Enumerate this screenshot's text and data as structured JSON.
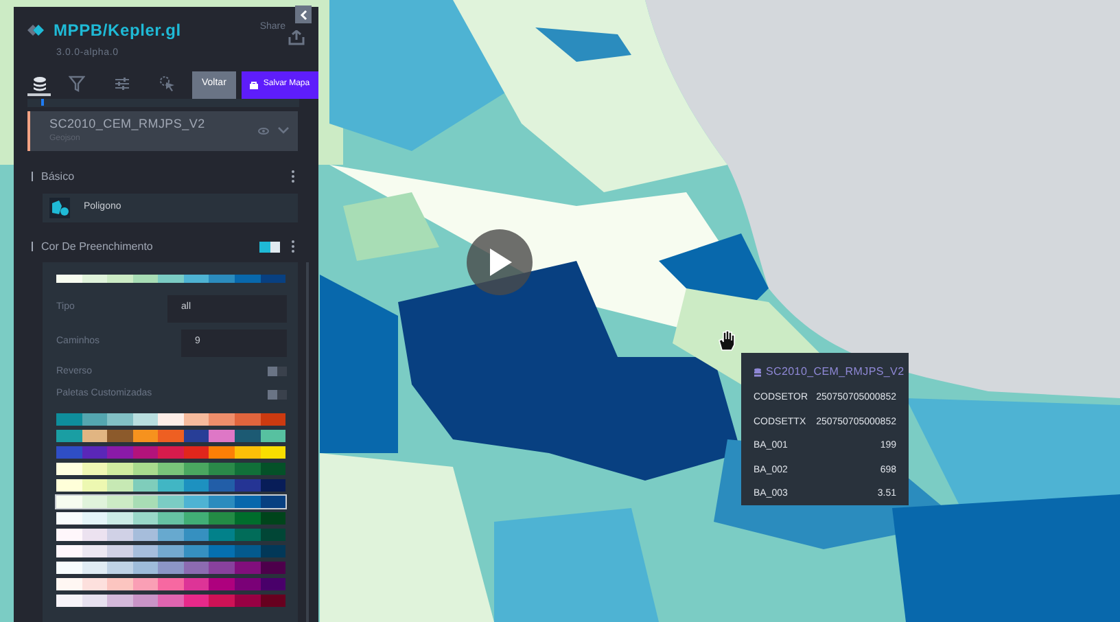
{
  "header": {
    "title": "MPPB/Kepler.gl",
    "version": "3.0.0-alpha.0",
    "share_label": "Share"
  },
  "tabs": [
    {
      "selected": true
    },
    {
      "selected": false
    },
    {
      "selected": false
    },
    {
      "selected": false
    }
  ],
  "buttons": [
    {
      "label": "Voltar",
      "kind": "secondary"
    },
    {
      "label": "Salvar Mapa",
      "kind": "primary"
    }
  ],
  "layer": {
    "name": "SC2010_CEM_RMJPS_V2",
    "source": "Geojson"
  },
  "basic_section": {
    "title": "Básico",
    "layer_type": "Poligono"
  },
  "fill_section": {
    "title": "Cor De Preenchimento",
    "scale": [
      {
        "color": "#f7fcf0"
      },
      {
        "color": "#e0f3db"
      },
      {
        "color": "#ccebc5"
      },
      {
        "color": "#a8ddb5"
      },
      {
        "color": "#7bccc4"
      },
      {
        "color": "#4eb3d3"
      },
      {
        "color": "#2b8cbe"
      },
      {
        "color": "#0868ac"
      },
      {
        "color": "#084081"
      }
    ],
    "fields": [
      {
        "label": "Tipo",
        "value": "all"
      },
      {
        "label": "Caminhos",
        "value": "9"
      }
    ],
    "toggles": [
      {
        "label": "Reverso",
        "on": false
      },
      {
        "label": "Paletas Customizadas",
        "on": false
      }
    ],
    "palettes": [
      {
        "selected": false,
        "colors": [
          {
            "color": "#0e8e9c"
          },
          {
            "color": "#54a6b0"
          },
          {
            "color": "#82c0c5"
          },
          {
            "color": "#b9dedf"
          },
          {
            "color": "#fdeee8"
          },
          {
            "color": "#f6bb9d"
          },
          {
            "color": "#ee8e6b"
          },
          {
            "color": "#e1653d"
          },
          {
            "color": "#cc3a10"
          }
        ]
      },
      {
        "selected": false,
        "colors": [
          {
            "color": "#1a9ea3"
          },
          {
            "color": "#e1b582"
          },
          {
            "color": "#8c5a2b"
          },
          {
            "color": "#f6921e"
          },
          {
            "color": "#ee5f22"
          },
          {
            "color": "#283e97"
          },
          {
            "color": "#de77c6"
          },
          {
            "color": "#1c5a73"
          },
          {
            "color": "#57c1a0"
          }
        ]
      },
      {
        "selected": false,
        "colors": [
          {
            "color": "#2f4ec5"
          },
          {
            "color": "#5a27b8"
          },
          {
            "color": "#8a1aa8"
          },
          {
            "color": "#b3137b"
          },
          {
            "color": "#d81b4c"
          },
          {
            "color": "#e1261c"
          },
          {
            "color": "#fb7f06"
          },
          {
            "color": "#fbbf08"
          },
          {
            "color": "#f9de00"
          }
        ]
      },
      {
        "selected": false,
        "colors": [
          {
            "color": "#ffffe0"
          },
          {
            "color": "#eff7b4"
          },
          {
            "color": "#d0eca0"
          },
          {
            "color": "#a9db8e"
          },
          {
            "color": "#79c47a"
          },
          {
            "color": "#4aa760"
          },
          {
            "color": "#2a8a49"
          },
          {
            "color": "#117039"
          },
          {
            "color": "#045128"
          }
        ]
      },
      {
        "selected": false,
        "colors": [
          {
            "color": "#ffffd9"
          },
          {
            "color": "#edf8b1"
          },
          {
            "color": "#c7e9b4"
          },
          {
            "color": "#7fcdbb"
          },
          {
            "color": "#41b6c4"
          },
          {
            "color": "#1d91c0"
          },
          {
            "color": "#225ea8"
          },
          {
            "color": "#253494"
          },
          {
            "color": "#081d58"
          }
        ]
      },
      {
        "selected": true,
        "colors": [
          {
            "color": "#f7fcf0"
          },
          {
            "color": "#e0f3db"
          },
          {
            "color": "#ccebc5"
          },
          {
            "color": "#a8ddb5"
          },
          {
            "color": "#7bccc4"
          },
          {
            "color": "#4eb3d3"
          },
          {
            "color": "#2b8cbe"
          },
          {
            "color": "#0868ac"
          },
          {
            "color": "#084081"
          }
        ]
      },
      {
        "selected": false,
        "colors": [
          {
            "color": "#f7fcfd"
          },
          {
            "color": "#e5f5f9"
          },
          {
            "color": "#ccece6"
          },
          {
            "color": "#99d8c9"
          },
          {
            "color": "#66c2a4"
          },
          {
            "color": "#41ae76"
          },
          {
            "color": "#238b45"
          },
          {
            "color": "#006d2c"
          },
          {
            "color": "#00441b"
          }
        ]
      },
      {
        "selected": false,
        "colors": [
          {
            "color": "#fff7fb"
          },
          {
            "color": "#ece2f0"
          },
          {
            "color": "#d0d1e6"
          },
          {
            "color": "#a6bddb"
          },
          {
            "color": "#67a9cf"
          },
          {
            "color": "#3690c0"
          },
          {
            "color": "#02818a"
          },
          {
            "color": "#016c59"
          },
          {
            "color": "#014636"
          }
        ]
      },
      {
        "selected": false,
        "colors": [
          {
            "color": "#fff7fc"
          },
          {
            "color": "#ece7f2"
          },
          {
            "color": "#d0d1e5"
          },
          {
            "color": "#a6bddc"
          },
          {
            "color": "#74a9cf"
          },
          {
            "color": "#3690c1"
          },
          {
            "color": "#0570b0"
          },
          {
            "color": "#045a8d"
          },
          {
            "color": "#023858"
          }
        ]
      },
      {
        "selected": false,
        "colors": [
          {
            "color": "#f7fcfe"
          },
          {
            "color": "#e0ecf4"
          },
          {
            "color": "#bfd3e6"
          },
          {
            "color": "#9ebcda"
          },
          {
            "color": "#8c96c6"
          },
          {
            "color": "#8c6bb1"
          },
          {
            "color": "#88419d"
          },
          {
            "color": "#810f7c"
          },
          {
            "color": "#4d004b"
          }
        ]
      },
      {
        "selected": false,
        "colors": [
          {
            "color": "#fff7f3"
          },
          {
            "color": "#fde0dd"
          },
          {
            "color": "#fcc5c0"
          },
          {
            "color": "#fa9fb5"
          },
          {
            "color": "#f768a1"
          },
          {
            "color": "#dd3497"
          },
          {
            "color": "#ae017e"
          },
          {
            "color": "#7a0177"
          },
          {
            "color": "#49006a"
          }
        ]
      },
      {
        "selected": false,
        "colors": [
          {
            "color": "#f7f4f9"
          },
          {
            "color": "#e7e1ef"
          },
          {
            "color": "#d4b9da"
          },
          {
            "color": "#c994c7"
          },
          {
            "color": "#df65b0"
          },
          {
            "color": "#e7298a"
          },
          {
            "color": "#ce1256"
          },
          {
            "color": "#980043"
          },
          {
            "color": "#67001f"
          }
        ]
      }
    ]
  },
  "tooltip": {
    "title": "SC2010_CEM_RMJPS_V2",
    "rows": [
      {
        "label": "CODSETOR",
        "value": "250750705000852"
      },
      {
        "label": "CODSETTX",
        "value": "250750705000852"
      },
      {
        "label": "BA_001",
        "value": "199"
      },
      {
        "label": "BA_002",
        "value": "698"
      },
      {
        "label": "BA_003",
        "value": "3.51"
      }
    ]
  }
}
